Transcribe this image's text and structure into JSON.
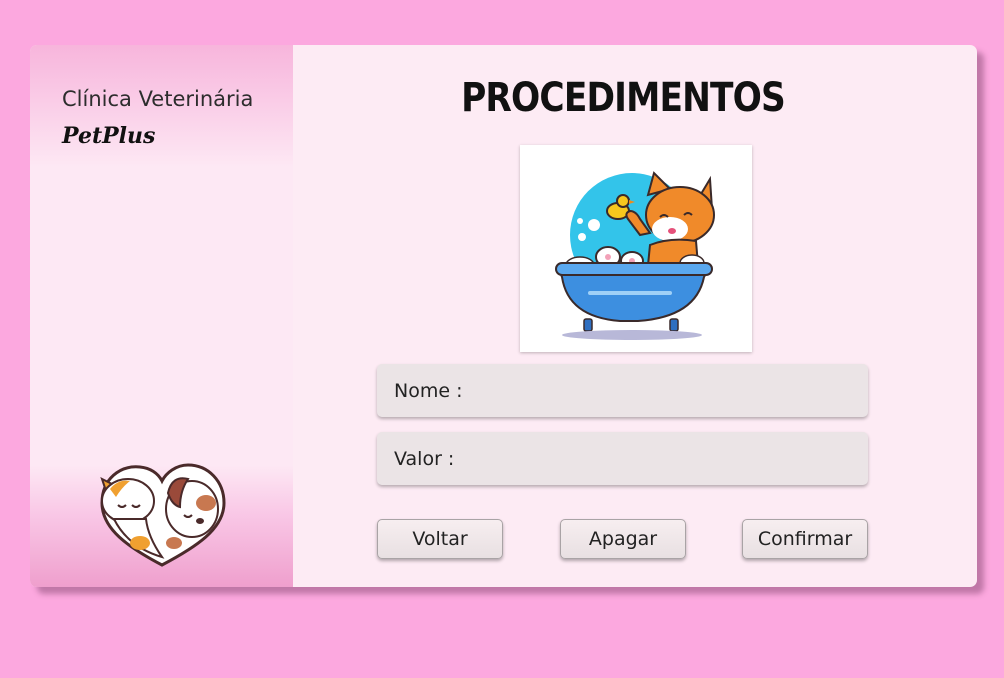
{
  "sidebar": {
    "clinic_name": "Clínica Veterinária",
    "brand": "PetPlus",
    "logo_icon": "cat-dog-heart-icon"
  },
  "main": {
    "title": "PROCEDIMENTOS",
    "hero_icon": "cat-in-bathtub-icon",
    "fields": {
      "nome_label": "Nome :",
      "nome_value": "",
      "valor_label": "Valor :",
      "valor_value": ""
    },
    "buttons": {
      "back": "Voltar",
      "delete": "Apagar",
      "confirm": "Confirmar"
    }
  },
  "colors": {
    "background": "#fca8df",
    "card": "#fdebf4",
    "field": "#ebe4e6"
  }
}
